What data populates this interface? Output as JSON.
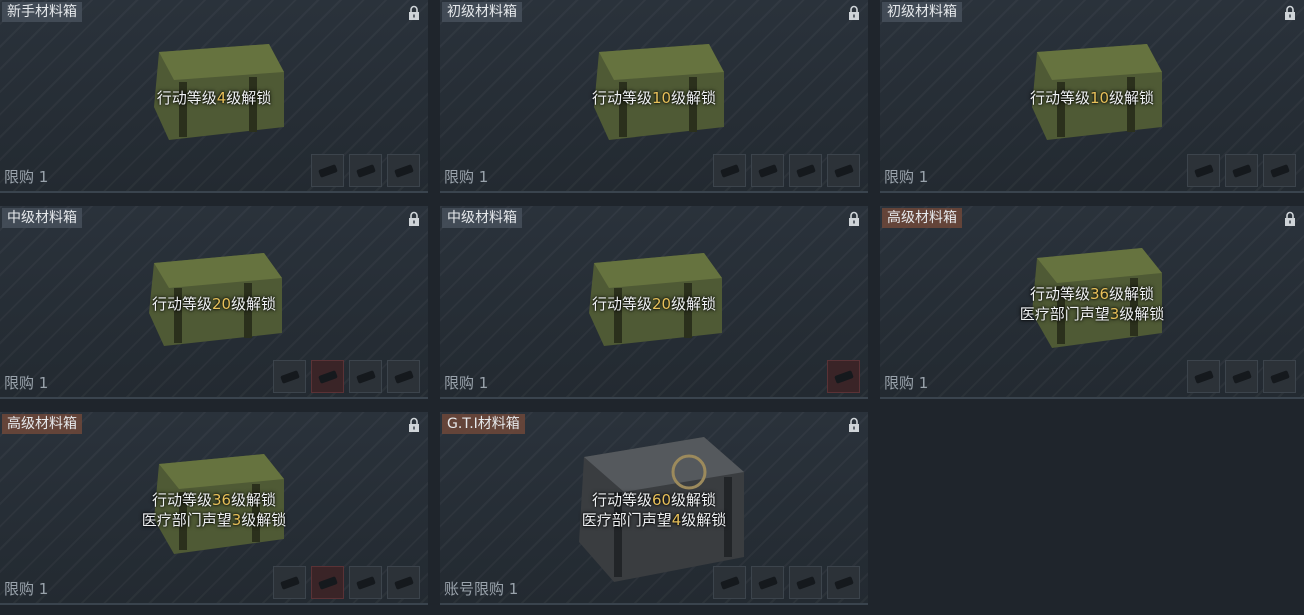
{
  "cards": [
    {
      "title": "新手材料箱",
      "unlock_pre": "行动等级",
      "level": "4",
      "unlock_post": "级解锁",
      "rep_pre": "",
      "rep": "",
      "rep_post": "",
      "limit": "限购 1",
      "box": "green"
    },
    {
      "title": "初级材料箱",
      "unlock_pre": "行动等级",
      "level": "10",
      "unlock_post": "级解锁",
      "rep_pre": "",
      "rep": "",
      "rep_post": "",
      "limit": "限购 1",
      "box": "green"
    },
    {
      "title": "初级材料箱",
      "unlock_pre": "行动等级",
      "level": "10",
      "unlock_post": "级解锁",
      "rep_pre": "",
      "rep": "",
      "rep_post": "",
      "limit": "限购 1",
      "box": "green"
    },
    {
      "title": "中级材料箱",
      "unlock_pre": "行动等级",
      "level": "20",
      "unlock_post": "级解锁",
      "rep_pre": "",
      "rep": "",
      "rep_post": "",
      "limit": "限购 1",
      "box": "green"
    },
    {
      "title": "中级材料箱",
      "unlock_pre": "行动等级",
      "level": "20",
      "unlock_post": "级解锁",
      "rep_pre": "",
      "rep": "",
      "rep_post": "",
      "limit": "限购 1",
      "box": "green"
    },
    {
      "title": "高级材料箱",
      "unlock_pre": "行动等级",
      "level": "36",
      "unlock_post": "级解锁",
      "rep_pre": "医疗部门声望",
      "rep": "3",
      "rep_post": "级解锁",
      "limit": "限购 1",
      "box": "green"
    },
    {
      "title": "高级材料箱",
      "unlock_pre": "行动等级",
      "level": "36",
      "unlock_post": "级解锁",
      "rep_pre": "医疗部门声望",
      "rep": "3",
      "rep_post": "级解锁",
      "limit": "限购 1",
      "box": "green"
    },
    {
      "title": "G.T.I材料箱",
      "unlock_pre": "行动等级",
      "level": "60",
      "unlock_post": "级解锁",
      "rep_pre": "医疗部门声望",
      "rep": "4",
      "rep_post": "级解锁",
      "limit": "账号限购 1",
      "box": "black"
    }
  ],
  "colors": {
    "highlight": "#e8c15a",
    "box_green": "#4f5a35",
    "box_black": "#3a3d40"
  }
}
